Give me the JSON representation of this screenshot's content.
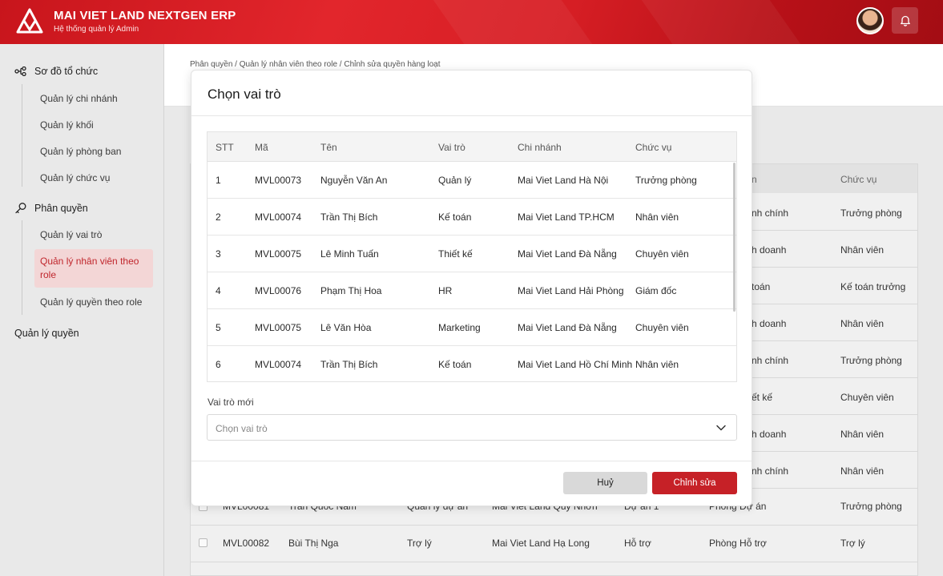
{
  "app": {
    "title": "MAI VIET LAND NEXTGEN ERP",
    "subtitle": "Hệ thống quản lý Admin"
  },
  "sidebar": {
    "org_group": "Sơ đồ tổ chức",
    "org_items": [
      "Quản lý chi nhánh",
      "Quản lý khối",
      "Quản lý phòng ban",
      "Quản lý chức vụ"
    ],
    "perm_group": "Phân quyền",
    "perm_items": [
      "Quản lý vai trò",
      "Quản lý nhân viên theo role",
      "Quản lý quyền theo role"
    ],
    "perm_active_index": 1,
    "rights_group": "Quản lý quyền"
  },
  "breadcrumb": "Phân quyền / Quản lý nhân viên theo role / Chỉnh sửa quyền hàng loạt",
  "background_table": {
    "headers": {
      "branch_partial": "n",
      "position": "Chức vụ"
    },
    "dept_partials": [
      "nh chính",
      "h doanh",
      "toán",
      "h doanh",
      "nh chính",
      "ết kế",
      "h doanh",
      "nh chính"
    ],
    "positions": [
      "Trưởng phòng",
      "Nhân viên",
      "Kế toán trưởng",
      "Nhân viên",
      "Trưởng phòng",
      "Chuyên viên",
      "Nhân viên",
      "Nhân viên"
    ],
    "rows": [
      {
        "code": "MVL00081",
        "name": "Trần Quốc Nam",
        "role": "Quản lý dự án",
        "branch": "Mai Viet Land Quy Nhơn",
        "block": "Dự án 1",
        "dept": "Phòng Dự án",
        "position": "Trưởng phòng"
      },
      {
        "code": "MVL00082",
        "name": "Bùi Thị Nga",
        "role": "Trợ lý",
        "branch": "Mai Viet Land Hạ Long",
        "block": "Hỗ trợ",
        "dept": "Phòng Hỗ trợ",
        "position": "Trợ lý"
      }
    ]
  },
  "modal": {
    "title": "Chọn vai trò",
    "columns": [
      "STT",
      "Mã",
      "Tên",
      "Vai trò",
      "Chi nhánh",
      "Chức vụ"
    ],
    "rows": [
      [
        "1",
        "MVL00073",
        "Nguyễn Văn An",
        "Quản lý",
        "Mai Viet Land Hà Nội",
        "Trưởng phòng"
      ],
      [
        "2",
        "MVL00074",
        "Trần Thị Bích",
        "Kế toán",
        "Mai Viet Land TP.HCM",
        "Nhân viên"
      ],
      [
        "3",
        "MVL00075",
        "Lê Minh Tuấn",
        "Thiết kế",
        "Mai Viet Land Đà Nẵng",
        "Chuyên viên"
      ],
      [
        "4",
        "MVL00076",
        "Phạm Thị Hoa",
        "HR",
        "Mai Viet Land Hải Phòng",
        "Giám đốc"
      ],
      [
        "5",
        "MVL00075",
        "Lê Văn Hòa",
        "Marketing",
        "Mai Viet Land Đà Nẵng",
        "Chuyên viên"
      ],
      [
        "6",
        "MVL00074",
        "Trần Thị Bích",
        "Kế toán",
        "Mai Viet Land Hồ Chí Minh",
        "Nhân viên"
      ]
    ],
    "field_label": "Vai trò mới",
    "select_placeholder": "Chọn vai trò",
    "cancel_label": "Huỷ",
    "submit_label": "Chỉnh sửa"
  },
  "colors": {
    "brand": "#d61e24",
    "active_bg": "#f3d6d6",
    "active_text": "#c0262c",
    "submit": "#c62127"
  }
}
